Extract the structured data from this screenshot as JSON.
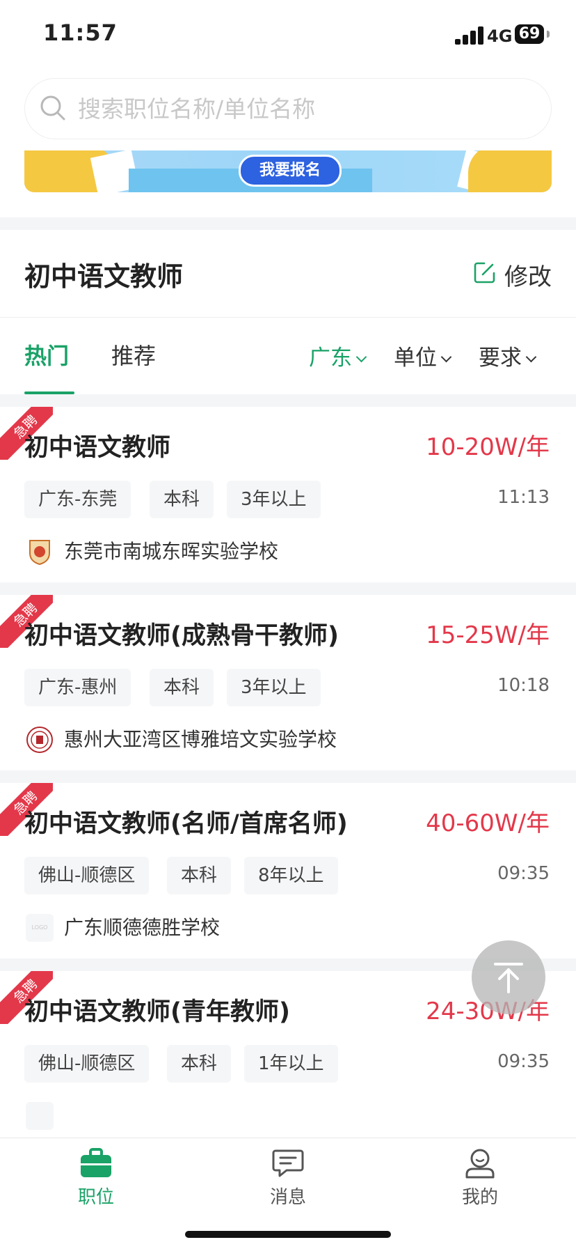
{
  "status_bar": {
    "time": "11:57",
    "network": "4G",
    "battery": "69"
  },
  "search": {
    "placeholder": "搜索职位名称/单位名称"
  },
  "banner": {
    "button_label": "我要报名"
  },
  "header": {
    "title": "初中语文教师",
    "edit_label": "修改"
  },
  "tabs": [
    {
      "label": "热门",
      "active": true
    },
    {
      "label": "推荐",
      "active": false
    }
  ],
  "filters": [
    {
      "label": "广东",
      "active": true
    },
    {
      "label": "单位",
      "active": false
    },
    {
      "label": "要求",
      "active": false
    }
  ],
  "jobs": [
    {
      "badge": "急聘",
      "title": "初中语文教师",
      "salary": "10-20W/年",
      "tags": [
        "广东-东莞",
        "本科",
        "3年以上"
      ],
      "time": "11:13",
      "org": "东莞市南城东晖实验学校"
    },
    {
      "badge": "急聘",
      "title": "初中语文教师(成熟骨干教师)",
      "salary": "15-25W/年",
      "tags": [
        "广东-惠州",
        "本科",
        "3年以上"
      ],
      "time": "10:18",
      "org": "惠州大亚湾区博雅培文实验学校"
    },
    {
      "badge": "急聘",
      "title": "初中语文教师(名师/首席名师)",
      "salary": "40-60W/年",
      "tags": [
        "佛山-顺德区",
        "本科",
        "8年以上"
      ],
      "time": "09:35",
      "org": "广东顺德德胜学校",
      "logo_text": "LOGO"
    },
    {
      "badge": "急聘",
      "title": "初中语文教师(青年教师)",
      "salary": "24-30W/年",
      "tags": [
        "佛山-顺德区",
        "本科",
        "1年以上"
      ],
      "time": "09:35",
      "org": ""
    }
  ],
  "tabbar": [
    {
      "label": "职位",
      "icon": "briefcase-icon",
      "active": true
    },
    {
      "label": "消息",
      "icon": "message-icon",
      "active": false
    },
    {
      "label": "我的",
      "icon": "profile-icon",
      "active": false
    }
  ],
  "colors": {
    "accent": "#1aa267",
    "salary": "#e3384a",
    "badge": "#e3384a"
  }
}
